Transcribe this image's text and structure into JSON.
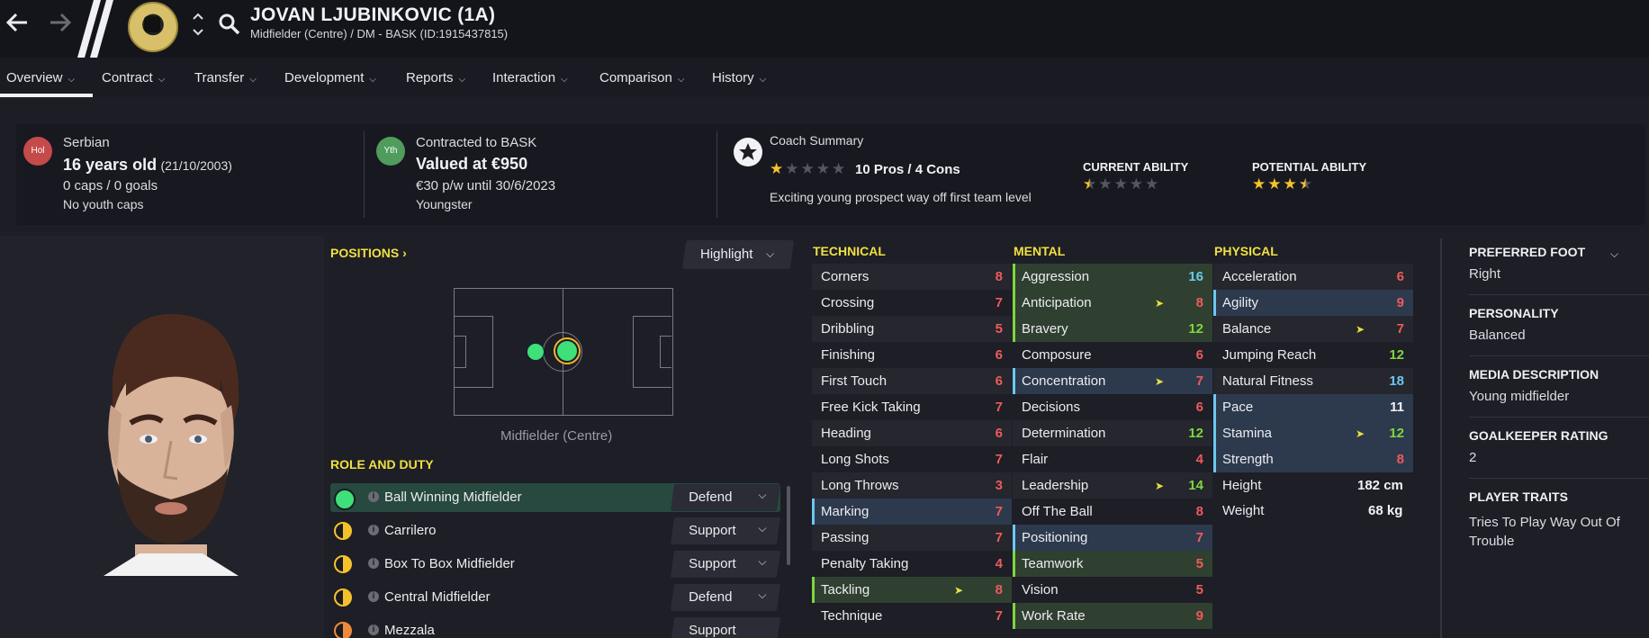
{
  "header": {
    "name": "JOVAN LJUBINKOVIC (1A)",
    "subtitle": "Midfielder (Centre) / DM - BASK (ID:1915437815)"
  },
  "tabs": [
    {
      "label": "Overview"
    },
    {
      "label": "Contract"
    },
    {
      "label": "Transfer"
    },
    {
      "label": "Development"
    },
    {
      "label": "Reports"
    },
    {
      "label": "Interaction"
    },
    {
      "label": "Comparison"
    },
    {
      "label": "History"
    }
  ],
  "summary": {
    "nation_badge": "Hol",
    "nationality": "Serbian",
    "age": "16 years old",
    "dob": "(21/10/2003)",
    "caps": "0 caps / 0 goals",
    "youth_caps": "No youth caps",
    "contract_badge": "Yth",
    "contracted_to": "Contracted to BASK",
    "value": "Valued at €950",
    "wage": "€30 p/w until 30/6/2023",
    "status": "Youngster",
    "coach_title": "Coach Summary",
    "pros_cons": "10 Pros / 4 Cons",
    "coach_text": "Exciting young prospect way off first team level",
    "coach_stars": 1,
    "current_ability_label": "CURRENT ABILITY",
    "current_ability_stars": 0.5,
    "potential_ability_label": "POTENTIAL ABILITY",
    "potential_ability_stars": 3.5
  },
  "positions": {
    "title": "POSITIONS",
    "highlight_label": "Highlight",
    "caption": "Midfielder (Centre)"
  },
  "role": {
    "title": "ROLE AND DUTY",
    "rows": [
      {
        "name": "Ball Winning Midfielder",
        "duty": "Defend"
      },
      {
        "name": "Carrilero",
        "duty": "Support"
      },
      {
        "name": "Box To Box Midfielder",
        "duty": "Support"
      },
      {
        "name": "Central Midfielder",
        "duty": "Defend"
      },
      {
        "name": "Mezzala",
        "duty": "Support"
      }
    ]
  },
  "technical": {
    "title": "TECHNICAL",
    "attrs": [
      {
        "name": "Corners",
        "value": "8"
      },
      {
        "name": "Crossing",
        "value": "7"
      },
      {
        "name": "Dribbling",
        "value": "5"
      },
      {
        "name": "Finishing",
        "value": "6"
      },
      {
        "name": "First Touch",
        "value": "6"
      },
      {
        "name": "Free Kick Taking",
        "value": "7"
      },
      {
        "name": "Heading",
        "value": "6"
      },
      {
        "name": "Long Shots",
        "value": "7"
      },
      {
        "name": "Long Throws",
        "value": "3"
      },
      {
        "name": "Marking",
        "value": "7"
      },
      {
        "name": "Passing",
        "value": "7"
      },
      {
        "name": "Penalty Taking",
        "value": "4"
      },
      {
        "name": "Tackling",
        "value": "8"
      },
      {
        "name": "Technique",
        "value": "7"
      }
    ]
  },
  "mental": {
    "title": "MENTAL",
    "attrs": [
      {
        "name": "Aggression",
        "value": "16"
      },
      {
        "name": "Anticipation",
        "value": "8"
      },
      {
        "name": "Bravery",
        "value": "12"
      },
      {
        "name": "Composure",
        "value": "6"
      },
      {
        "name": "Concentration",
        "value": "7"
      },
      {
        "name": "Decisions",
        "value": "6"
      },
      {
        "name": "Determination",
        "value": "12"
      },
      {
        "name": "Flair",
        "value": "4"
      },
      {
        "name": "Leadership",
        "value": "14"
      },
      {
        "name": "Off The Ball",
        "value": "8"
      },
      {
        "name": "Positioning",
        "value": "7"
      },
      {
        "name": "Teamwork",
        "value": "5"
      },
      {
        "name": "Vision",
        "value": "5"
      },
      {
        "name": "Work Rate",
        "value": "9"
      }
    ]
  },
  "physical": {
    "title": "PHYSICAL",
    "attrs": [
      {
        "name": "Acceleration",
        "value": "6"
      },
      {
        "name": "Agility",
        "value": "9"
      },
      {
        "name": "Balance",
        "value": "7"
      },
      {
        "name": "Jumping Reach",
        "value": "12"
      },
      {
        "name": "Natural Fitness",
        "value": "18"
      },
      {
        "name": "Pace",
        "value": "11"
      },
      {
        "name": "Stamina",
        "value": "12"
      },
      {
        "name": "Strength",
        "value": "8"
      }
    ],
    "height_label": "Height",
    "height_value": "182 cm",
    "weight_label": "Weight",
    "weight_value": "68 kg"
  },
  "info": {
    "preferred_foot_label": "PREFERRED FOOT",
    "preferred_foot": "Right",
    "personality_label": "PERSONALITY",
    "personality": "Balanced",
    "media_label": "MEDIA DESCRIPTION",
    "media": "Young midfielder",
    "gk_label": "GOALKEEPER RATING",
    "gk": "2",
    "traits_label": "PLAYER TRAITS",
    "traits": "Tries To Play Way Out Of Trouble"
  }
}
